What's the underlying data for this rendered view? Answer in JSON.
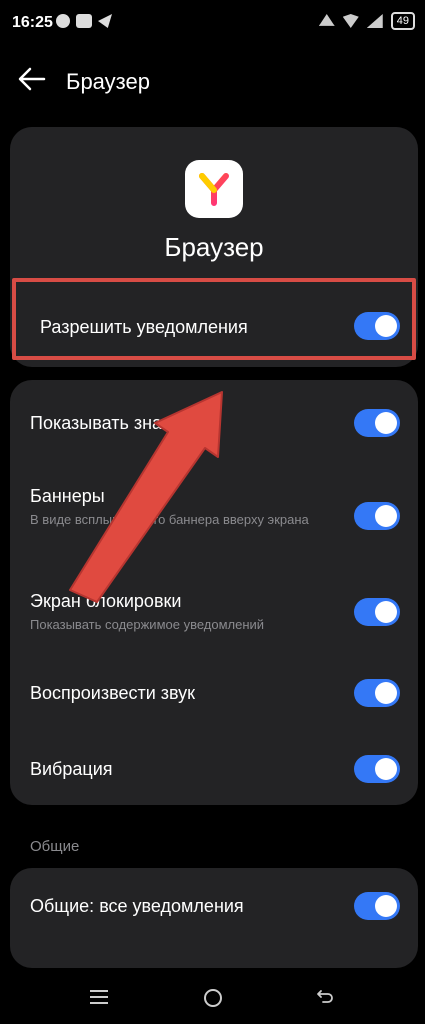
{
  "status": {
    "time": "16:25",
    "battery": "49"
  },
  "header": {
    "title": "Браузер"
  },
  "app": {
    "name": "Браузер"
  },
  "rows": {
    "allow": {
      "label": "Разрешить уведомления",
      "on": true
    },
    "show": {
      "label": "Показывать зна",
      "on": true
    },
    "banners": {
      "label": "Баннеры",
      "sub": "В виде всплывающего баннера вверху экрана",
      "on": true
    },
    "lock": {
      "label": "Экран блокировки",
      "sub": "Показывать содержимое уведомлений",
      "on": true
    },
    "sound": {
      "label": "Воспроизвести звук",
      "on": true
    },
    "vibration": {
      "label": "Вибрация",
      "on": true
    }
  },
  "general": {
    "section_label": "Общие",
    "all": {
      "label": "Общие: все уведомления",
      "on": true
    }
  },
  "colors": {
    "accent": "#3478f6",
    "highlight": "#d74c45",
    "card": "#232325"
  }
}
